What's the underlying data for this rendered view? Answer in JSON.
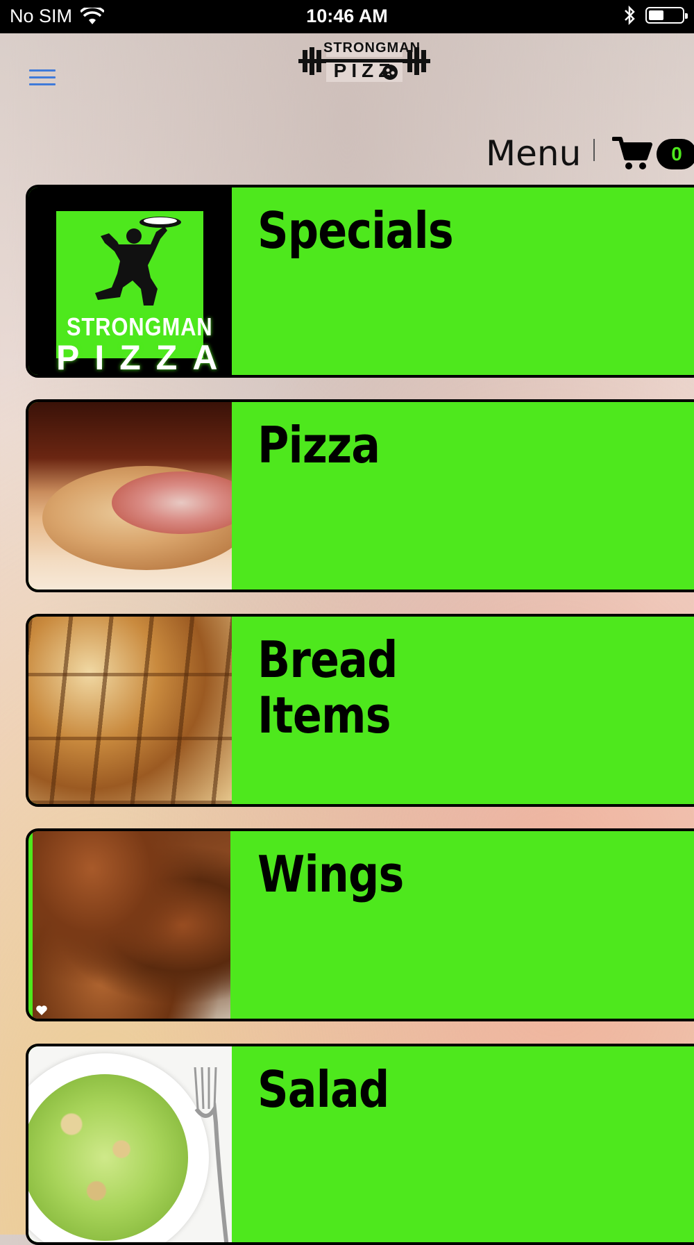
{
  "status_bar": {
    "carrier": "No SIM",
    "time": "10:46 AM",
    "battery_level": 0.45,
    "icons": [
      "wifi-icon",
      "bluetooth-icon",
      "battery-icon"
    ]
  },
  "header": {
    "logo_top": "STRONGMAN",
    "logo_bottom": "PIZZ",
    "menu_label": "Menu",
    "cart_count": "0"
  },
  "colors": {
    "accent_green": "#4ee81d",
    "hamburger_blue": "#3f7ad9",
    "black": "#000000"
  },
  "categories": [
    {
      "title": "Specials",
      "image": "strongman-pizza-logo"
    },
    {
      "title": "Pizza",
      "image": "pizza-photo"
    },
    {
      "title_line1": "Bread",
      "title_line2": "Items",
      "image": "breadsticks-photo"
    },
    {
      "title": "Wings",
      "image": "wings-photo"
    },
    {
      "title": "Salad",
      "image": "salad-photo"
    }
  ],
  "specials_logo": {
    "line1": "STRONGMAN",
    "line2": "PIZZA"
  }
}
